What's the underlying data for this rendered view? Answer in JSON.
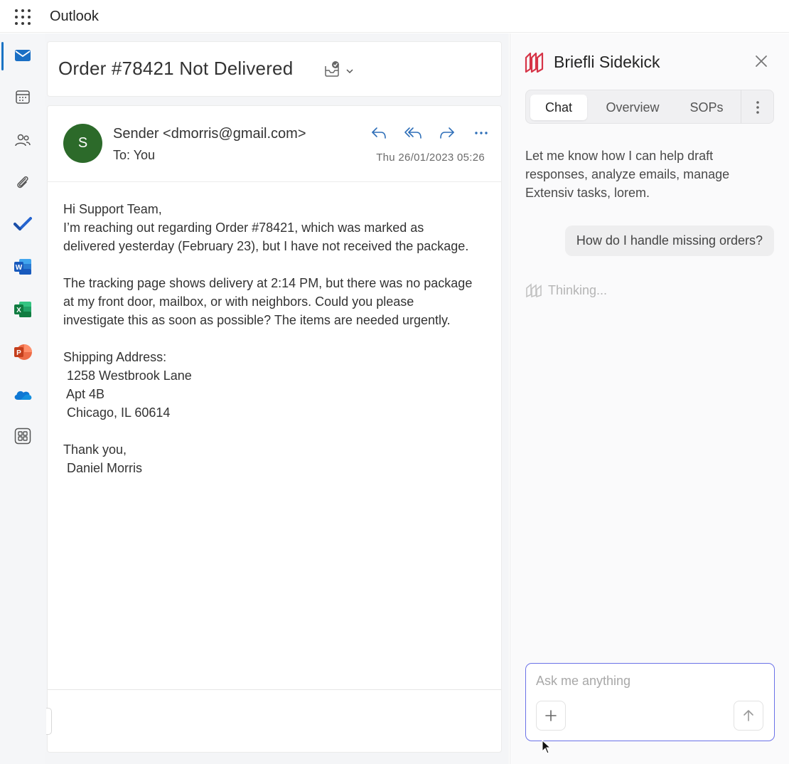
{
  "app": {
    "title": "Outlook"
  },
  "rail": {
    "items": [
      {
        "icon": "mail-icon",
        "active": true
      },
      {
        "icon": "calendar-icon"
      },
      {
        "icon": "people-icon"
      },
      {
        "icon": "attachment-icon"
      },
      {
        "icon": "todo-icon"
      },
      {
        "icon": "word-icon"
      },
      {
        "icon": "excel-icon"
      },
      {
        "icon": "powerpoint-icon"
      },
      {
        "icon": "onedrive-icon"
      },
      {
        "icon": "apps-icon"
      }
    ]
  },
  "email": {
    "subject": "Order #78421 Not Delivered",
    "avatar_initial": "S",
    "sender": "Sender <dmorris@gmail.com>",
    "to": "To:  You",
    "date": "Thu 26/01/2023 05:26",
    "body": [
      "Hi Support Team,",
      "I’m reaching out regarding Order #78421, which was marked as",
      "delivered yesterday (February 23), but I have not received the package.",
      "",
      "The tracking page shows delivery at 2:14 PM, but there was no package",
      "at my front door, mailbox, or with neighbors. Could you please",
      "investigate this as soon as possible? The items are needed urgently.",
      "",
      "Shipping Address:",
      " 1258 Westbrook Lane",
      " Apt 4B",
      " Chicago, IL 60614",
      "",
      "Thank you,",
      " Daniel Morris"
    ]
  },
  "sidekick": {
    "title": "Briefli Sidekick",
    "tabs": [
      "Chat",
      "Overview",
      "SOPs"
    ],
    "active_tab": "Chat",
    "intro": "Let me know how I can help draft responses, analyze emails, manage Extensiv tasks, lorem.",
    "user_message": "How do I handle missing orders?",
    "thinking": "Thinking...",
    "composer_placeholder": "Ask me anything"
  },
  "colors": {
    "accent": "#1a73c4",
    "avatar": "#2c6a2a",
    "brand": "#d63447",
    "composer_border": "#6b72e8"
  }
}
